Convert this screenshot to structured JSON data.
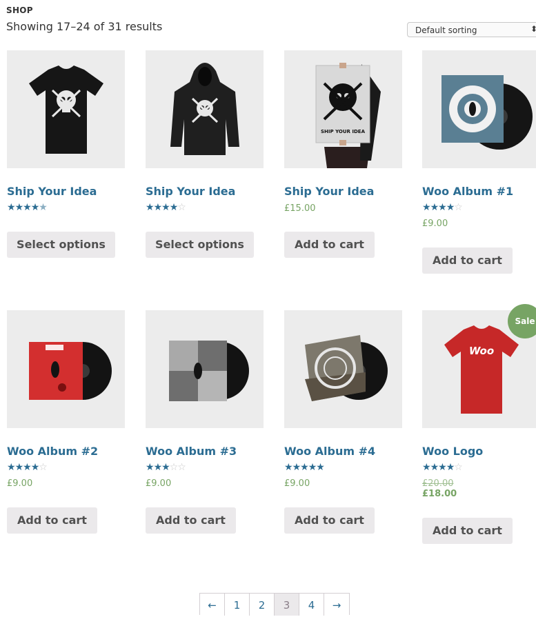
{
  "breadcrumb": "SHOP",
  "result_count": "Showing 17–24 of 31 results",
  "sorting": {
    "selected": "Default sorting",
    "arrow": "⬍"
  },
  "products": [
    {
      "title": "Ship Your Idea",
      "rating": 4.5,
      "price": "",
      "button": "Select options",
      "image": "black-tshirt"
    },
    {
      "title": "Ship Your Idea",
      "rating": 4,
      "price": "",
      "button": "Select options",
      "image": "black-hoodie"
    },
    {
      "title": "Ship Your Idea",
      "rating": null,
      "price": "£15.00",
      "button": "Add to cart",
      "image": "poster"
    },
    {
      "title": "Woo Album #1",
      "rating": 4,
      "price": "£9.00",
      "button": "Add to cart",
      "image": "album-blue"
    },
    {
      "title": "Woo Album #2",
      "rating": 4,
      "price": "£9.00",
      "button": "Add to cart",
      "image": "album-red"
    },
    {
      "title": "Woo Album #3",
      "rating": 3,
      "price": "£9.00",
      "button": "Add to cart",
      "image": "album-grey"
    },
    {
      "title": "Woo Album #4",
      "rating": 5,
      "price": "£9.00",
      "button": "Add to cart",
      "image": "album-photo"
    },
    {
      "title": "Woo Logo",
      "rating": 4,
      "old_price": "£20.00",
      "price": "£18.00",
      "button": "Add to cart",
      "image": "red-tshirt",
      "badge": "Sale"
    }
  ],
  "poster_text": "SHIP YOUR IDEA",
  "tshirt_logo": "Woo",
  "pagination": {
    "prev": "←",
    "pages": [
      "1",
      "2",
      "3",
      "4"
    ],
    "current": "3",
    "next": "→"
  },
  "colors": {
    "link": "#2b6c92",
    "price": "#77a464",
    "button_bg": "#ebe9eb",
    "sale_badge": "#77a464"
  }
}
